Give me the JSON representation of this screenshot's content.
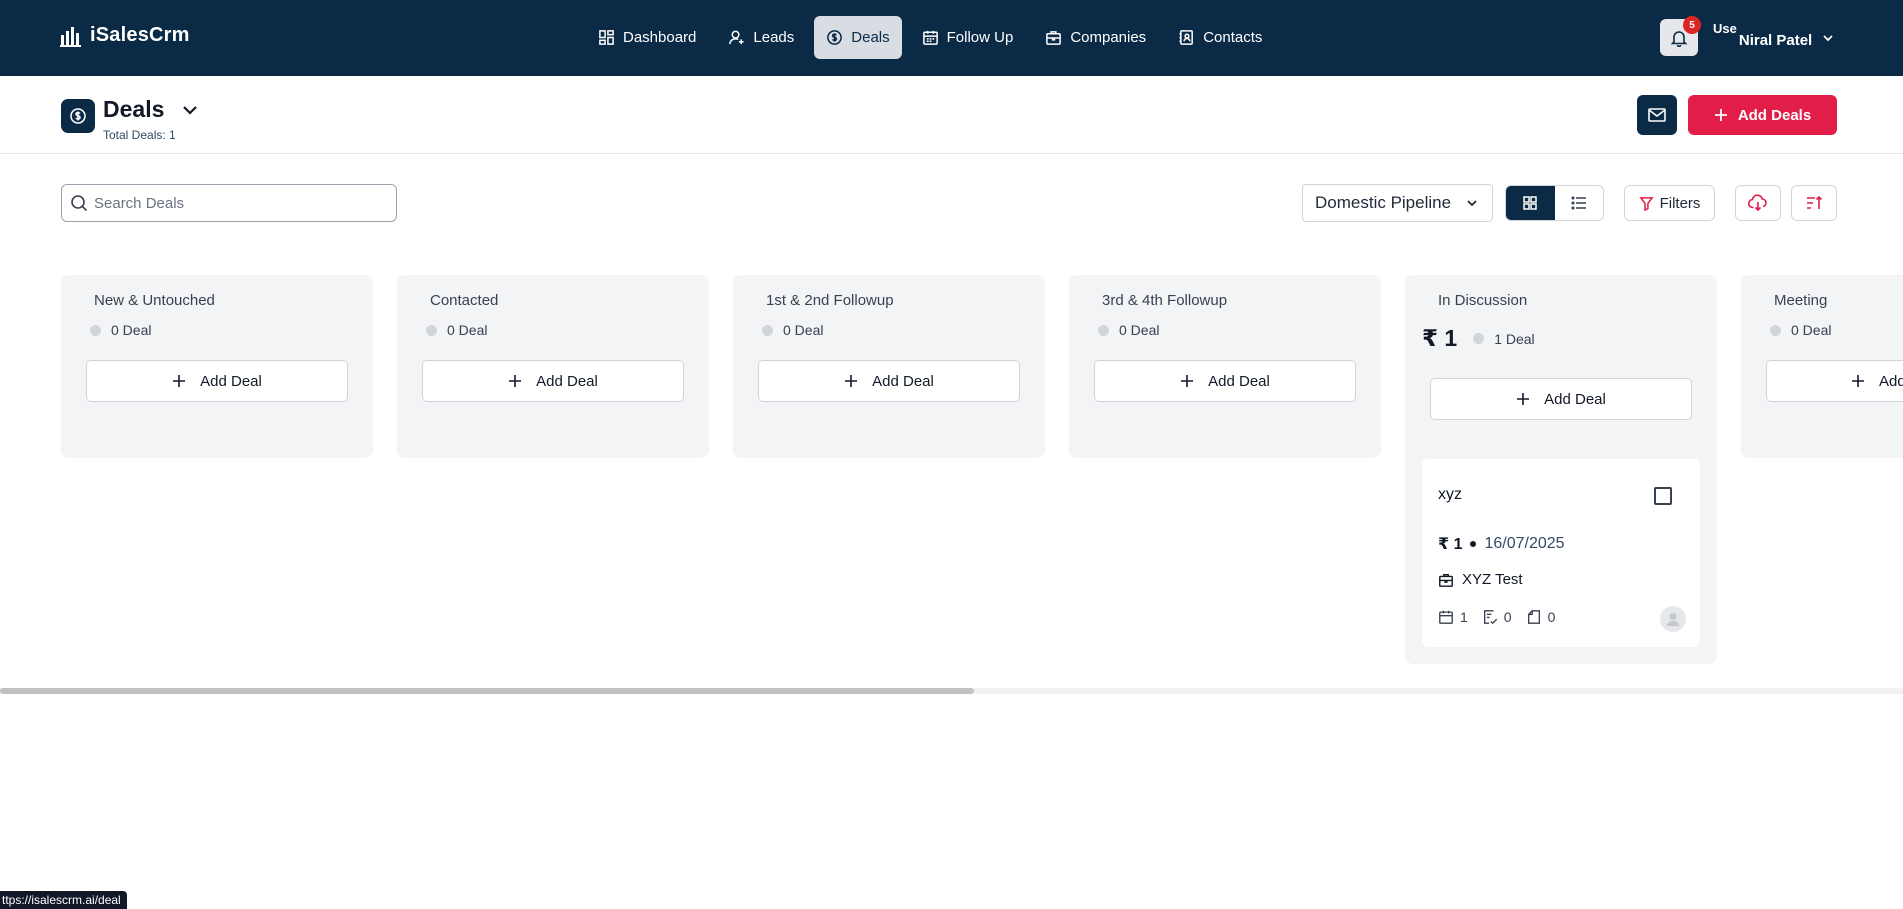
{
  "app": {
    "name": "iSalesCrm"
  },
  "nav": {
    "items": [
      {
        "label": "Dashboard",
        "icon": "grid-icon"
      },
      {
        "label": "Leads",
        "icon": "user-plus-icon"
      },
      {
        "label": "Deals",
        "icon": "dollar-circle-icon",
        "active": true
      },
      {
        "label": "Follow Up",
        "icon": "calendar-icon"
      },
      {
        "label": "Companies",
        "icon": "briefcase-icon"
      },
      {
        "label": "Contacts",
        "icon": "contact-book-icon"
      }
    ]
  },
  "notifications": {
    "count": "5"
  },
  "user": {
    "avatar_alt": "Use",
    "name": "Niral Patel"
  },
  "page": {
    "title": "Deals",
    "subtitle": "Total Deals: 1",
    "add_button": "Add Deals"
  },
  "toolbar": {
    "search_placeholder": "Search Deals",
    "pipeline": "Domestic Pipeline",
    "filters_label": "Filters"
  },
  "colors": {
    "navy": "#0b2a45",
    "accent": "#e11d48",
    "badge": "#dc2626"
  },
  "board": {
    "columns": [
      {
        "title": "New & Untouched",
        "count": "0 Deal",
        "add_label": "Add Deal"
      },
      {
        "title": "Contacted",
        "count": "0 Deal",
        "add_label": "Add Deal"
      },
      {
        "title": "1st & 2nd Followup",
        "count": "0 Deal",
        "add_label": "Add Deal"
      },
      {
        "title": "3rd & 4th Followup",
        "count": "0 Deal",
        "add_label": "Add Deal"
      },
      {
        "title": "In Discussion",
        "amount": "₹ 1",
        "count": "1 Deal",
        "add_label": "Add Deal"
      },
      {
        "title": "Meeting",
        "count": "0 Deal",
        "add_label": "Add Deal"
      }
    ],
    "deal": {
      "title": "xyz",
      "amount": "₹ 1",
      "date": "16/07/2025",
      "company": "XYZ Test",
      "followups": "1",
      "tasks": "0",
      "notes": "0"
    }
  },
  "status_bar": {
    "url": "ttps://isalescrm.ai/deal"
  }
}
